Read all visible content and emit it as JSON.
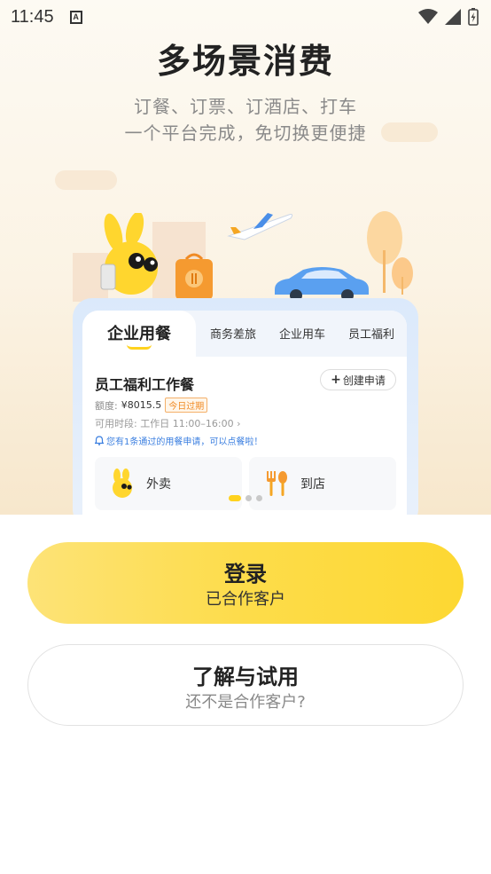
{
  "status_bar": {
    "time": "11:45",
    "notification_letter": "A"
  },
  "hero": {
    "title": "多场景消费",
    "subtitle_line1": "订餐、订票、订酒店、打车",
    "subtitle_line2": "一个平台完成，免切换更便捷"
  },
  "card": {
    "tabs": [
      {
        "label": "企业用餐",
        "active": true
      },
      {
        "label": "商务差旅"
      },
      {
        "label": "企业用车"
      },
      {
        "label": "员工福利"
      }
    ],
    "meal_title": "员工福利工作餐",
    "create_button": "创建申请",
    "quota_label": "额度:",
    "quota_value": "¥8015.5",
    "expire_tag": "今日过期",
    "time_label": "可用时段:",
    "time_value": "工作日 11:00–16:00",
    "notice": "您有1条通过的用餐申请，可以点餐啦！",
    "options": [
      {
        "label": "外卖",
        "icon": "mascot-icon"
      },
      {
        "label": "到店",
        "icon": "cutlery-icon"
      }
    ],
    "carousel_active_index": 0,
    "carousel_count": 3
  },
  "buttons": {
    "login_main": "登录",
    "login_sub": "已合作客户",
    "trial_main": "了解与试用",
    "trial_sub": "还不是合作客户?"
  },
  "colors": {
    "accent_yellow": "#fdd832",
    "tab_underline": "#ffd21e",
    "notice_blue": "#3b7fe0",
    "expire_orange": "#f08a24"
  }
}
